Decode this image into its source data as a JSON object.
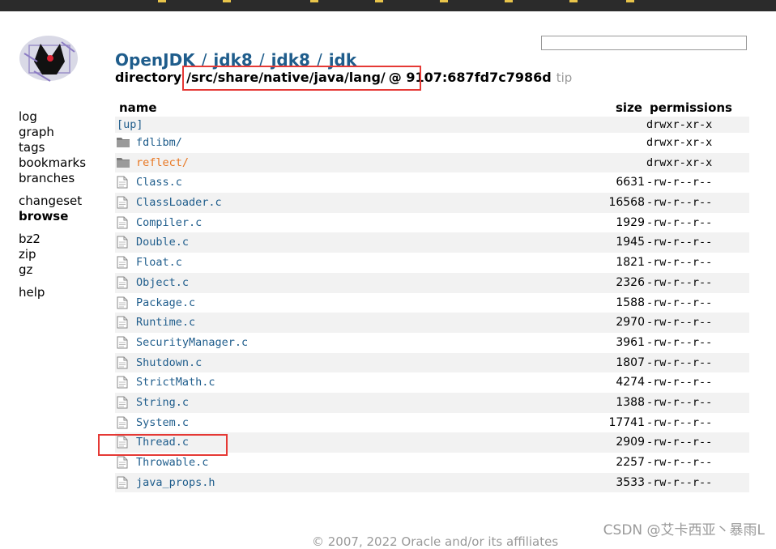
{
  "header": {
    "crumbs": [
      "OpenJDK",
      "jdk8",
      "jdk8",
      "jdk"
    ],
    "separator": "/",
    "directory_label": "directory",
    "path": "/src/share/native/java/lang/",
    "at_sign": "@",
    "changeset": "9107:687fd7c7986d",
    "tip": "tip"
  },
  "search": {
    "value": ""
  },
  "sidebar": {
    "groups": [
      [
        {
          "label": "log"
        },
        {
          "label": "graph"
        },
        {
          "label": "tags"
        },
        {
          "label": "bookmarks"
        },
        {
          "label": "branches"
        }
      ],
      [
        {
          "label": "changeset"
        },
        {
          "label": "browse",
          "active": true
        }
      ],
      [
        {
          "label": "bz2"
        },
        {
          "label": "zip"
        },
        {
          "label": "gz"
        }
      ],
      [
        {
          "label": "help"
        }
      ]
    ]
  },
  "table": {
    "columns": {
      "name": "name",
      "size": "size",
      "permissions": "permissions"
    },
    "rows": [
      {
        "name": "[up]",
        "size": "",
        "perm": "drwxr-xr-x",
        "kind": "up"
      },
      {
        "name": "fdlibm/",
        "size": "",
        "perm": "drwxr-xr-x",
        "kind": "dir"
      },
      {
        "name": "reflect/",
        "size": "",
        "perm": "drwxr-xr-x",
        "kind": "dir",
        "visited": true
      },
      {
        "name": "Class.c",
        "size": "6631",
        "perm": "-rw-r--r--",
        "kind": "file"
      },
      {
        "name": "ClassLoader.c",
        "size": "16568",
        "perm": "-rw-r--r--",
        "kind": "file"
      },
      {
        "name": "Compiler.c",
        "size": "1929",
        "perm": "-rw-r--r--",
        "kind": "file"
      },
      {
        "name": "Double.c",
        "size": "1945",
        "perm": "-rw-r--r--",
        "kind": "file"
      },
      {
        "name": "Float.c",
        "size": "1821",
        "perm": "-rw-r--r--",
        "kind": "file"
      },
      {
        "name": "Object.c",
        "size": "2326",
        "perm": "-rw-r--r--",
        "kind": "file"
      },
      {
        "name": "Package.c",
        "size": "1588",
        "perm": "-rw-r--r--",
        "kind": "file"
      },
      {
        "name": "Runtime.c",
        "size": "2970",
        "perm": "-rw-r--r--",
        "kind": "file"
      },
      {
        "name": "SecurityManager.c",
        "size": "3961",
        "perm": "-rw-r--r--",
        "kind": "file"
      },
      {
        "name": "Shutdown.c",
        "size": "1807",
        "perm": "-rw-r--r--",
        "kind": "file"
      },
      {
        "name": "StrictMath.c",
        "size": "4274",
        "perm": "-rw-r--r--",
        "kind": "file"
      },
      {
        "name": "String.c",
        "size": "1388",
        "perm": "-rw-r--r--",
        "kind": "file"
      },
      {
        "name": "System.c",
        "size": "17741",
        "perm": "-rw-r--r--",
        "kind": "file"
      },
      {
        "name": "Thread.c",
        "size": "2909",
        "perm": "-rw-r--r--",
        "kind": "file"
      },
      {
        "name": "Throwable.c",
        "size": "2257",
        "perm": "-rw-r--r--",
        "kind": "file"
      },
      {
        "name": "java_props.h",
        "size": "3533",
        "perm": "-rw-r--r--",
        "kind": "file"
      }
    ]
  },
  "colors": {
    "link": "#1f5d8c",
    "visited": "#e87722",
    "highlight": "#e53935",
    "stripe": "#f2f2f2"
  },
  "watermark": "CSDN @艾卡西亚丶暴雨L",
  "footer": "© 2007, 2022 Oracle and/or its affiliates"
}
